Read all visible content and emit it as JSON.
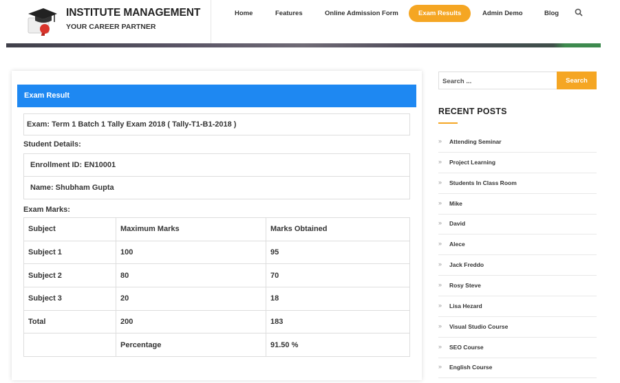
{
  "brand": {
    "title": "INSTITUTE MANAGEMENT",
    "subtitle": "YOUR CAREER PARTNER"
  },
  "nav": {
    "items": [
      "Home",
      "Features",
      "Online Admission Form",
      "Exam Results",
      "Admin Demo",
      "Blog"
    ],
    "active": "Exam Results",
    "search_icon": "search-icon"
  },
  "result": {
    "header": "Exam Result",
    "exam": "Exam: Term 1 Batch 1 Tally Exam 2018 ( Tally-T1-B1-2018 )",
    "student_details_label": "Student Details:",
    "enrollment": "Enrollment ID: EN10001",
    "name": "Name: Shubham Gupta",
    "marks_label": "Exam Marks:",
    "columns": [
      "Subject",
      "Maximum Marks",
      "Marks Obtained"
    ],
    "rows": [
      [
        "Subject 1",
        "100",
        "95"
      ],
      [
        "Subject 2",
        "80",
        "70"
      ],
      [
        "Subject 3",
        "20",
        "18"
      ],
      [
        "Total",
        "200",
        "183"
      ],
      [
        "",
        "Percentage",
        "91.50 %"
      ]
    ]
  },
  "sidebar": {
    "search_placeholder": "Search ...",
    "search_button": "Search",
    "recent_title": "RECENT POSTS",
    "posts": [
      "Attending Seminar",
      "Project Learning",
      "Students In Class Room",
      "Mike",
      "David",
      "Alece",
      "Jack Freddo",
      "Rosy Steve",
      "Lisa Hezard",
      "Visual Studio Course",
      "SEO Course",
      "English Course"
    ]
  },
  "colors": {
    "accent": "#f5a623",
    "primary": "#1e88f2"
  }
}
